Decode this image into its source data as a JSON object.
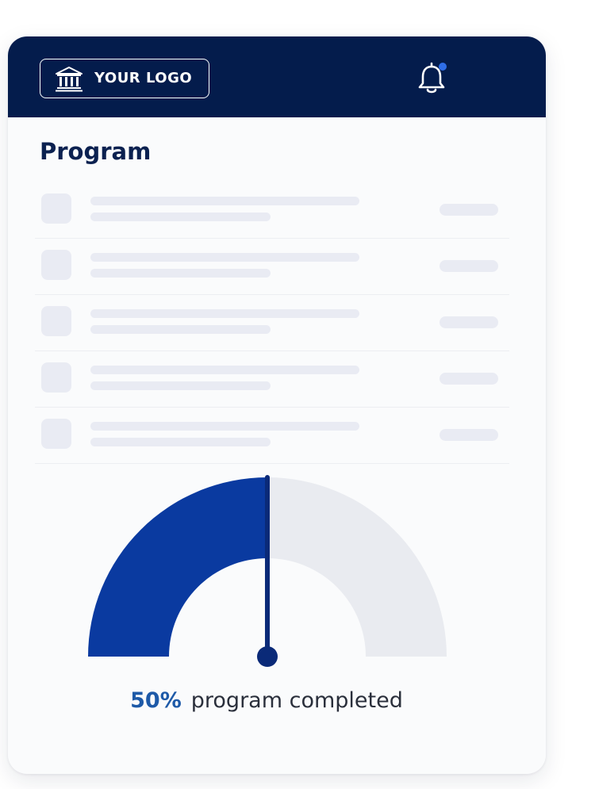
{
  "header": {
    "logo_text": "YOUR LOGO",
    "logo_icon": "bank-building-icon",
    "notification_icon": "bell-icon",
    "notification_dot_color": "#2f6ee8",
    "background_color": "#041c4c"
  },
  "program": {
    "title": "Program",
    "rows": [
      {
        "id": 1
      },
      {
        "id": 2
      },
      {
        "id": 3
      },
      {
        "id": 4
      },
      {
        "id": 5
      }
    ]
  },
  "progress": {
    "percent": 50,
    "percent_label": "50%",
    "label": "program completed",
    "fill_color": "#0a3aa0",
    "track_color": "#e9ebf0"
  }
}
